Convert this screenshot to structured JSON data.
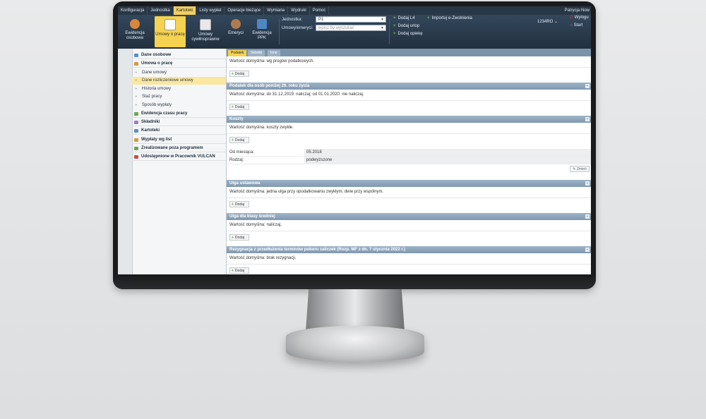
{
  "menu": {
    "items": [
      "Konfiguracja",
      "Jednostka",
      "Kartoteki",
      "Listy wypłat",
      "Operacje bieżące",
      "Wymiana",
      "Wydruki",
      "Pomoc"
    ],
    "active_index": 2,
    "user": "Patrycja Now"
  },
  "toolbar": {
    "buttons": [
      "Ewidencja osobowa",
      "Umowy o pracę",
      "Umowy cywilnoprawne",
      "Emeryci",
      "Ewidencja PPK"
    ],
    "active_index": 1,
    "jednostka_label": "Jednostka:",
    "jednostka_value": "P1",
    "umowy_label": "Umowy/emeryci:",
    "umowy_placeholder": "wpisz by wyszukać",
    "links": [
      "Dodaj L4",
      "Dodaj urlop",
      "Dodaj opiekę",
      "Importuj e-Zwolnienia"
    ],
    "code": "1234RO",
    "logout": "Wylogu",
    "start": "Start"
  },
  "sidebar": {
    "items": [
      {
        "label": "Dane osobowe",
        "type": "main",
        "color": "#5a8fc2"
      },
      {
        "label": "Umowa o pracę",
        "type": "main",
        "color": "#d79a3c"
      },
      {
        "label": "Dane umowy",
        "type": "sub",
        "active": false
      },
      {
        "label": "Dane rozliczeniowe umowy",
        "type": "sub",
        "active": true
      },
      {
        "label": "Historia umowy",
        "type": "sub",
        "active": false
      },
      {
        "label": "Staż pracy",
        "type": "sub",
        "active": false
      },
      {
        "label": "Sposób wypłaty",
        "type": "sub",
        "active": false
      },
      {
        "label": "Ewidencja czasu pracy",
        "type": "main",
        "color": "#6aa84f"
      },
      {
        "label": "Składniki",
        "type": "main",
        "color": "#a37ac4"
      },
      {
        "label": "Kartoteki",
        "type": "main",
        "color": "#5a8fc2"
      },
      {
        "label": "Wypłaty wg list",
        "type": "main",
        "color": "#d79a3c"
      },
      {
        "label": "Zrealizowane poza programem",
        "type": "main",
        "color": "#6aa84f"
      },
      {
        "label": "Udostępnione w Pracownik VULCAN",
        "type": "main",
        "color": "#c0504d"
      }
    ]
  },
  "tabs": [
    "Podatek",
    "Składki",
    "Inne"
  ],
  "active_tab": 0,
  "add_label": "Dodaj",
  "edit_label": "Zmień",
  "sections": {
    "s0": {
      "default": "Wartość domyślna: wg progów podatkowych."
    },
    "s1": {
      "title": "Podatek dla osób poniżej 26. roku życia",
      "default": "Wartość domyślna: do 31.12.2019: naliczaj; od 01.01.2020: nie naliczaj."
    },
    "s2": {
      "title": "Koszty",
      "default": "Wartość domyślna: koszty zwykłe.",
      "kv": [
        {
          "key": "Od miesiąca:",
          "value": "05.2018"
        },
        {
          "key": "Rodzaj:",
          "value": "podwyższone"
        }
      ]
    },
    "s3": {
      "title": "Ulga ustawowa",
      "default": "Wartość domyślna: jedna ulga przy opodatkowaniu zwykłym, dwie przy wspólnym."
    },
    "s4": {
      "title": "Ulga dla klasy średniej",
      "default": "Wartość domyślna: naliczaj."
    },
    "s5": {
      "title": "Rezygnacja z przedłużenia terminów poboru zaliczek (Rozp. MF z dn. 7 stycznia 2022 r.)",
      "default": "Wartość domyślna: brak rezygnacji."
    }
  },
  "icons": {
    "collapse": "collapse-icon",
    "plus": "plus-icon",
    "pencil": "pencil-icon",
    "dropdown": "chevron-down-icon"
  },
  "colors": {
    "menu_bg": "#283746",
    "active": "#f5d24f",
    "section_header": "#8aa1b8"
  }
}
